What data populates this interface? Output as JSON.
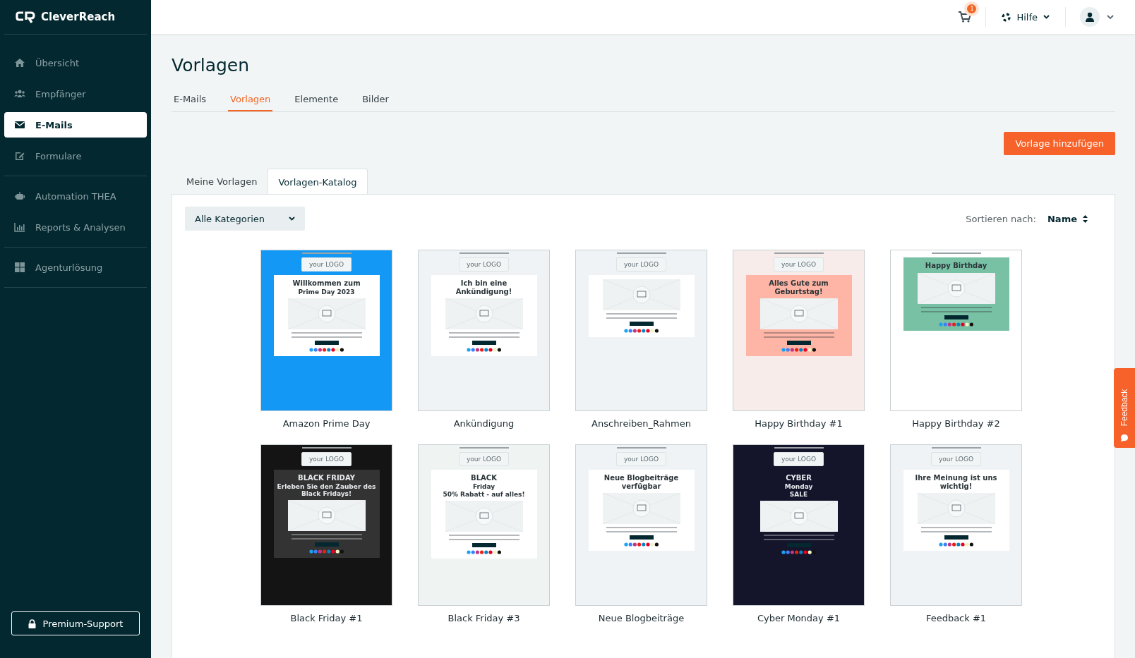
{
  "brand": "CleverReach",
  "sidebar": {
    "groups": [
      [
        {
          "label": "Übersicht",
          "selected": false
        },
        {
          "label": "Empfänger",
          "selected": false
        },
        {
          "label": "E-Mails",
          "selected": true
        },
        {
          "label": "Formulare",
          "selected": false
        }
      ],
      [
        {
          "label": "Automation THEA",
          "selected": false
        },
        {
          "label": "Reports & Analysen",
          "selected": false
        }
      ],
      [
        {
          "label": "Agenturlösung",
          "selected": false
        }
      ]
    ],
    "support_button": "Premium-Support"
  },
  "topbar": {
    "cart_badge": "1",
    "help": "Hilfe"
  },
  "page_title": "Vorlagen",
  "tabs": [
    {
      "label": "E-Mails",
      "selected": false
    },
    {
      "label": "Vorlagen",
      "selected": true
    },
    {
      "label": "Elemente",
      "selected": false
    },
    {
      "label": "Bilder",
      "selected": false
    }
  ],
  "add_button": "Vorlage hinzufügen",
  "subtabs": [
    {
      "label": "Meine Vorlagen",
      "selected": false
    },
    {
      "label": "Vorlagen-Katalog",
      "selected": true
    }
  ],
  "category_select": "Alle Kategorien",
  "sort": {
    "label": "Sortieren nach:",
    "value": "Name"
  },
  "templates": [
    {
      "name": "Amazon Prime Day",
      "color": "#1399f5",
      "kind": "light",
      "logo": "your LOGO",
      "headings": [
        "Willkommen zum",
        "Prime Day 2023"
      ]
    },
    {
      "name": "Ankündigung",
      "color": "#eff3f6",
      "kind": "light",
      "logo": "your LOGO",
      "headings": [
        "Ich bin eine Ankündigung!"
      ]
    },
    {
      "name": "Anschreiben_Rahmen",
      "color": "#eff3f6",
      "kind": "light",
      "logo": "your LOGO"
    },
    {
      "name": "Happy Birthday #1",
      "color": "#f7ece9",
      "kind": "salmon",
      "logo": "your LOGO",
      "headings": [
        "Alles Gute zum Geburtstag!"
      ]
    },
    {
      "name": "Happy Birthday #2",
      "color": "#ffffff",
      "kind": "green",
      "headings": [
        "Happy Birthday"
      ]
    },
    {
      "name": "Black Friday #1",
      "color": "#141414",
      "kind": "dark",
      "logo": "your LOGO",
      "headings": [
        "BLACK FRIDAY",
        "Erleben Sie den Zauber des Black Fridays!"
      ]
    },
    {
      "name": "Black Friday #3",
      "color": "#eff4f3",
      "kind": "light",
      "logo": "your LOGO",
      "headings": [
        "BLACK",
        "Friday",
        "50% Rabatt - auf alles!"
      ]
    },
    {
      "name": "Neue Blogbeiträge",
      "color": "#eff3f6",
      "kind": "light",
      "logo": "your LOGO",
      "headings": [
        "Neue Blogbeiträge verfügbar"
      ]
    },
    {
      "name": "Cyber Monday #1",
      "color": "#14152b",
      "kind": "navy",
      "logo": "your LOGO",
      "headings": [
        "CYBER",
        "Monday",
        "SALE"
      ]
    },
    {
      "name": "Feedback #1",
      "color": "#eff3f6",
      "kind": "light",
      "logo": "your LOGO",
      "headings": [
        "Ihre Meinung ist uns wichtig!"
      ]
    }
  ],
  "feedback_tab": "Feedback"
}
